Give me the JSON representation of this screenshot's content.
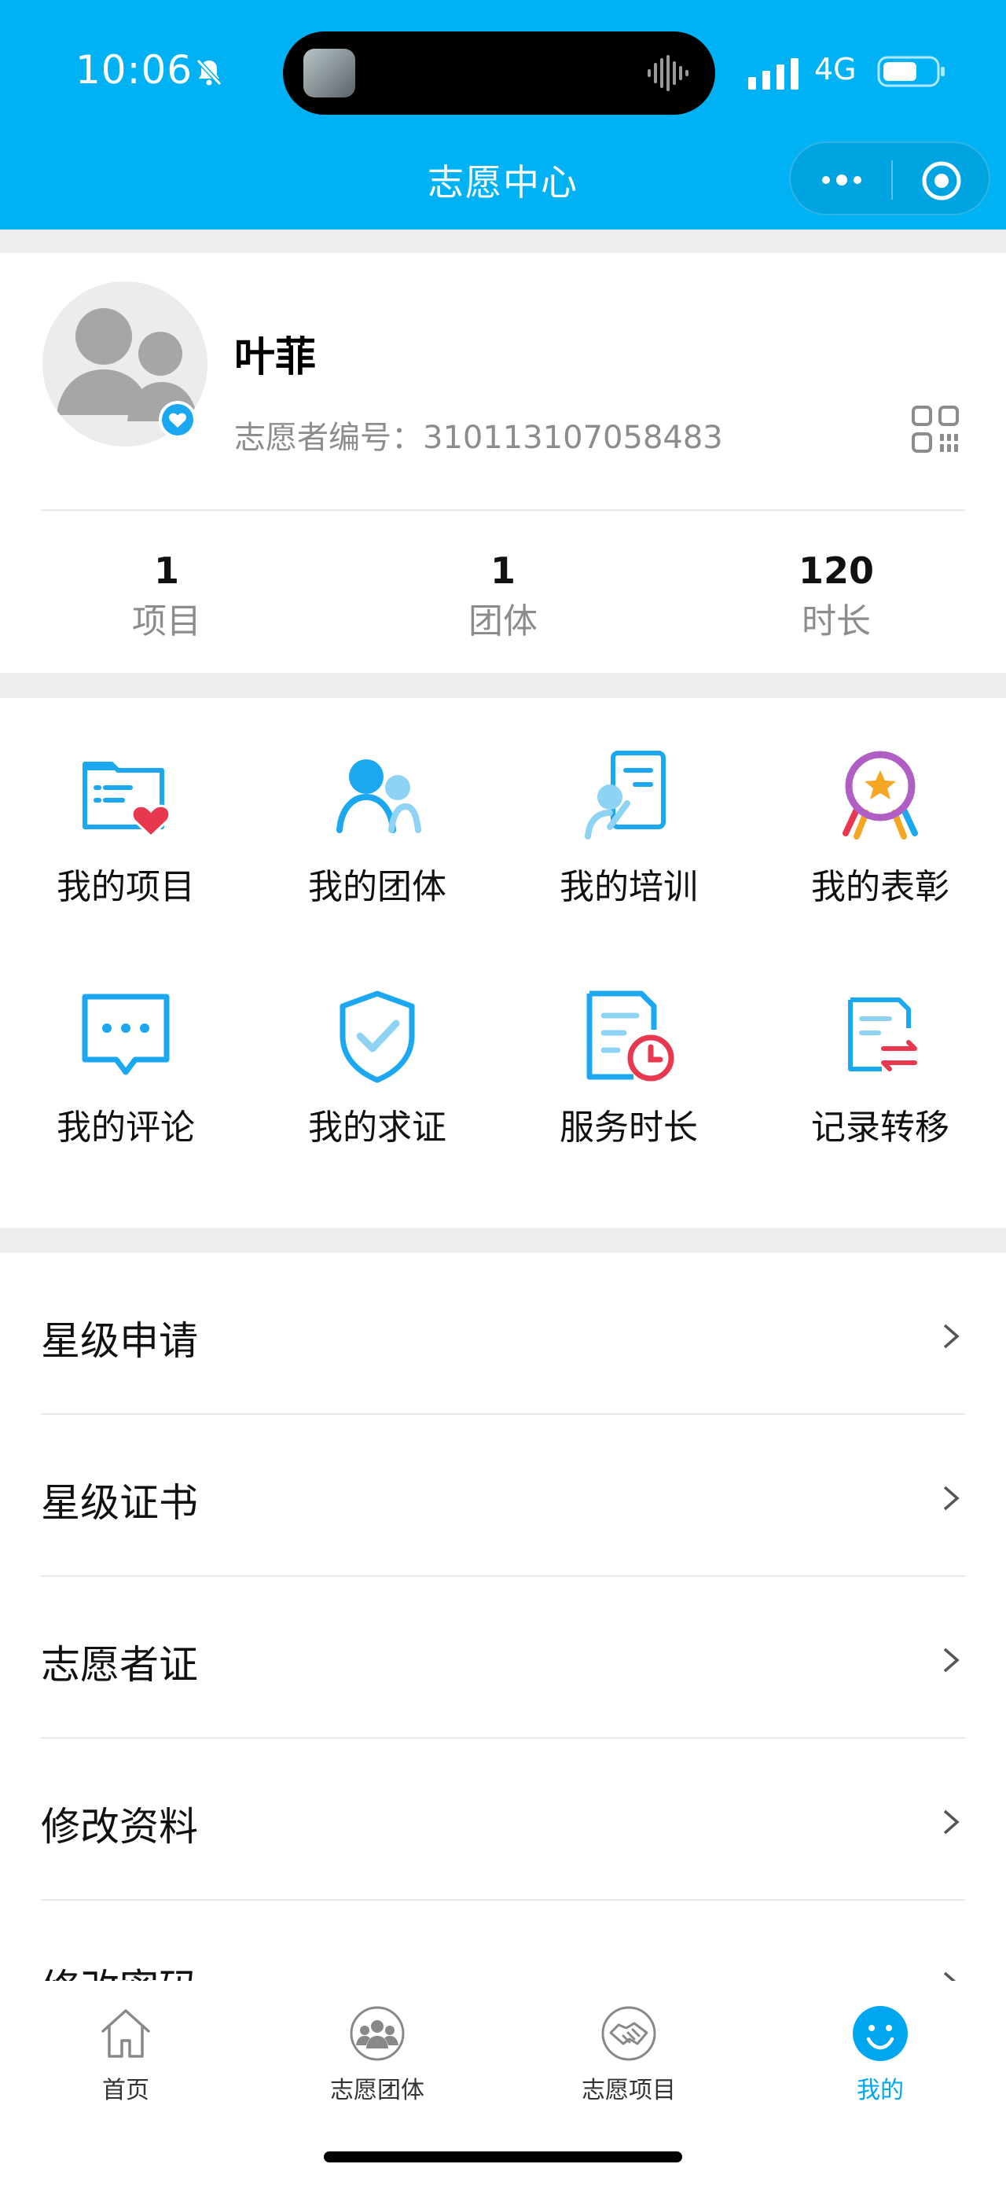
{
  "status_bar": {
    "time": "10:06",
    "network": "4G"
  },
  "header": {
    "title": "志愿中心"
  },
  "profile": {
    "name": "叶菲",
    "id_label": "志愿者编号：",
    "id_value": "310113107058483"
  },
  "stats": [
    {
      "value": "1",
      "label": "项目"
    },
    {
      "value": "1",
      "label": "团体"
    },
    {
      "value": "120",
      "label": "时长"
    }
  ],
  "grid": [
    {
      "label": "我的项目",
      "icon": "folder-heart-icon"
    },
    {
      "label": "我的团体",
      "icon": "group-icon"
    },
    {
      "label": "我的培训",
      "icon": "training-icon"
    },
    {
      "label": "我的表彰",
      "icon": "medal-icon"
    },
    {
      "label": "我的评论",
      "icon": "comment-icon"
    },
    {
      "label": "我的求证",
      "icon": "shield-check-icon"
    },
    {
      "label": "服务时长",
      "icon": "clock-document-icon"
    },
    {
      "label": "记录转移",
      "icon": "transfer-document-icon"
    }
  ],
  "list": [
    {
      "label": "星级申请"
    },
    {
      "label": "星级证书"
    },
    {
      "label": "志愿者证"
    },
    {
      "label": "修改资料"
    },
    {
      "label": "修改密码"
    }
  ],
  "tabs": [
    {
      "label": "首页",
      "icon": "home-icon",
      "active": false
    },
    {
      "label": "志愿团体",
      "icon": "group-circle-icon",
      "active": false
    },
    {
      "label": "志愿项目",
      "icon": "handshake-icon",
      "active": false
    },
    {
      "label": "我的",
      "icon": "smile-icon",
      "active": true
    }
  ],
  "colors": {
    "brand": "#00b2f3",
    "accent_red": "#e8384f",
    "tab_active": "#00a6f0"
  }
}
